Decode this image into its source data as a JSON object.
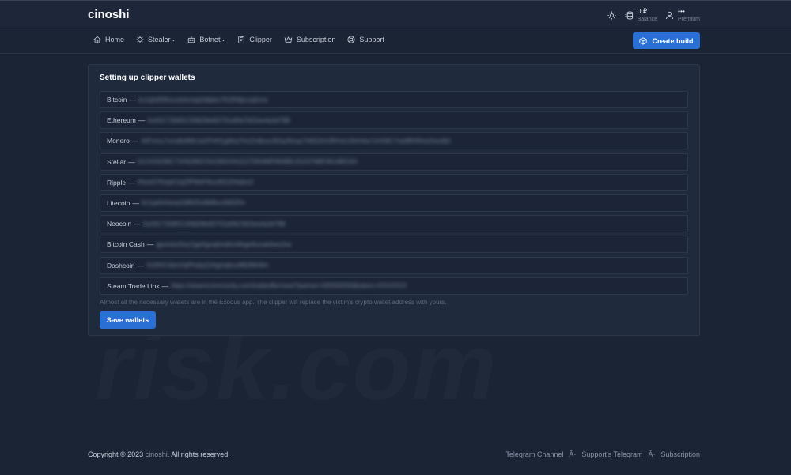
{
  "header": {
    "brand": "cinoshi",
    "balance_value": "0 ₽",
    "balance_label": "Balance",
    "account_dots": "•••",
    "account_label": "Premium",
    "icons": [
      "sun-icon",
      "database-icon",
      "user-icon"
    ]
  },
  "nav": {
    "items": [
      {
        "label": "Home",
        "icon": "home-icon"
      },
      {
        "label": "Stealer",
        "icon": "virus-icon",
        "dropdown": true
      },
      {
        "label": "Botnet",
        "icon": "robot-icon",
        "dropdown": true
      },
      {
        "label": "Clipper",
        "icon": "clipboard-icon"
      },
      {
        "label": "Subscription",
        "icon": "crown-icon"
      },
      {
        "label": "Support",
        "icon": "lifebuoy-icon"
      }
    ],
    "create_label": "Create build"
  },
  "card": {
    "title": "Setting up clipper wallets",
    "wallets": [
      {
        "label": "Bitcoin",
        "sep": "—",
        "value": "bc1q0d5f9svxdxkmwjsh8pktv7lh2fh8pcxq5vrw"
      },
      {
        "label": "Ethereum",
        "sep": "—",
        "value": "0xA5C72b9f1C93bD8e6D701d0fa7b52ee4a3d79B"
      },
      {
        "label": "Monero",
        "sep": "—",
        "value": "44Fvmu7vmdfs9MhJaXFhfrf1gMrq7HzZmBvwJ9ZqJNvsp7h8S2hh3RHxhJ3hH4w7xHA9C7rad8R4Nvtz5sw9jX"
      },
      {
        "label": "Stellar",
        "sep": "—",
        "value": "GCVXSOMC7VH5ZMSTAX2MXXHLEZ7DR4MPIMSBEJGZ47NBFWU4BGSA"
      },
      {
        "label": "Ripple",
        "sep": "—",
        "value": "rNvwD7KepK1lqZfPWeF9vxd5G2Hwbm2"
      },
      {
        "label": "Litecoin",
        "sep": "—",
        "value": "ltc1qa0nhwvp2dlfk55u9k8kuc9d02fm"
      },
      {
        "label": "Neocoin",
        "sep": "—",
        "value": "0xA5C72b9f1C93bD8e6D701d0fa7b52ee4a3d79B"
      },
      {
        "label": "Bitcoin Cash",
        "sep": "—",
        "value": "qpmcks2lxq7gqr5gnq0mdhm6hge9ucwk4wn2ne"
      },
      {
        "label": "Dashcoin",
        "sep": "—",
        "value": "XoSHCnbmXqPhskp2zAgmqkuuMb3Mn9m"
      },
      {
        "label": "Steam Trade Link",
        "sep": "—",
        "value": "https://steamcommunity.com/tradeoffer/new/?partner=000000000&token=XXXXXXX"
      }
    ],
    "hint": "Almost all the necessary wallets are in the Exodus app. The clipper will replace the victim's crypto wallet address with yours.",
    "save_label": "Save wallets"
  },
  "watermark": "risk.com",
  "footer": {
    "copyright_prefix": "Copyright © 2023",
    "brand": "cinoshi",
    "copyright_suffix": ". All rights reserved.",
    "links": [
      "Telegram Channel",
      "Support's Telegram",
      "Subscription"
    ],
    "separator": "Â·"
  },
  "colors": {
    "background": "#1b2435",
    "accent": "#2a6fd4",
    "card": "#1f2a3d"
  }
}
